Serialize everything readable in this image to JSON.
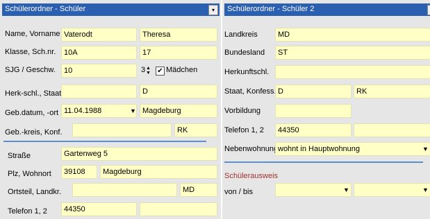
{
  "left_panel": {
    "title": "Schülerordner - Schüler",
    "dropdown_glyph": "▾",
    "labels": {
      "name": "Name, Vorname",
      "klasse": "Klasse, Sch.nr.",
      "sjg": "SJG / Geschw.",
      "herk": "Herk-schl., Staat",
      "geb": "Geb.datum, -ort",
      "gebkreis": "Geb.-kreis, Konf.",
      "strasse": "Straße",
      "plz": "Plz, Wohnort",
      "ortsteil": "Ortsteil, Landkr.",
      "telefon": "Telefon 1, 2"
    },
    "values": {
      "nachname": "Vaterodt",
      "vorname": "Theresa",
      "klasse": "10A",
      "schnr": "17",
      "sjg": "10",
      "geschw": "3",
      "herkschl": "",
      "staat": "D",
      "gebdatum": "11.04.1988",
      "gebort": "Magdeburg",
      "gebkreis": "",
      "konf": "RK",
      "strasse": "Gartenweg 5",
      "plz": "39108",
      "wohnort": "Magdeburg",
      "ortsteil": "",
      "landkr": "MD",
      "telefon1": "44350",
      "telefon2": ""
    },
    "maedchen_label": "Mädchen",
    "maedchen_checked": true,
    "check_glyph": "✔",
    "arrow_glyph": "▼",
    "spin_up": "▲",
    "spin_down": "▼"
  },
  "right_panel": {
    "title": "Schülerordner - Schüler 2",
    "dropdown_glyph": "▾",
    "labels": {
      "landkreis": "Landkreis",
      "bundesland": "Bundesland",
      "herkunft": "Herkunftschl.",
      "staat": "Staat, Konfess.",
      "vorbildung": "Vorbildung",
      "telefon": "Telefon 1, 2",
      "nebenwohnung": "Nebenwohnung",
      "ausweis": "Schülerausweis",
      "vonbis": "von / bis"
    },
    "values": {
      "landkreis": "MD",
      "bundesland": "ST",
      "herkunft": "",
      "staat": "D",
      "konfess": "RK",
      "vorbildung": "",
      "telefon1": "44350",
      "telefon2": "",
      "nebenwohnung": "wohnt in Hauptwohnung",
      "von": "",
      "bis": ""
    },
    "arrow_glyph": "▼"
  }
}
